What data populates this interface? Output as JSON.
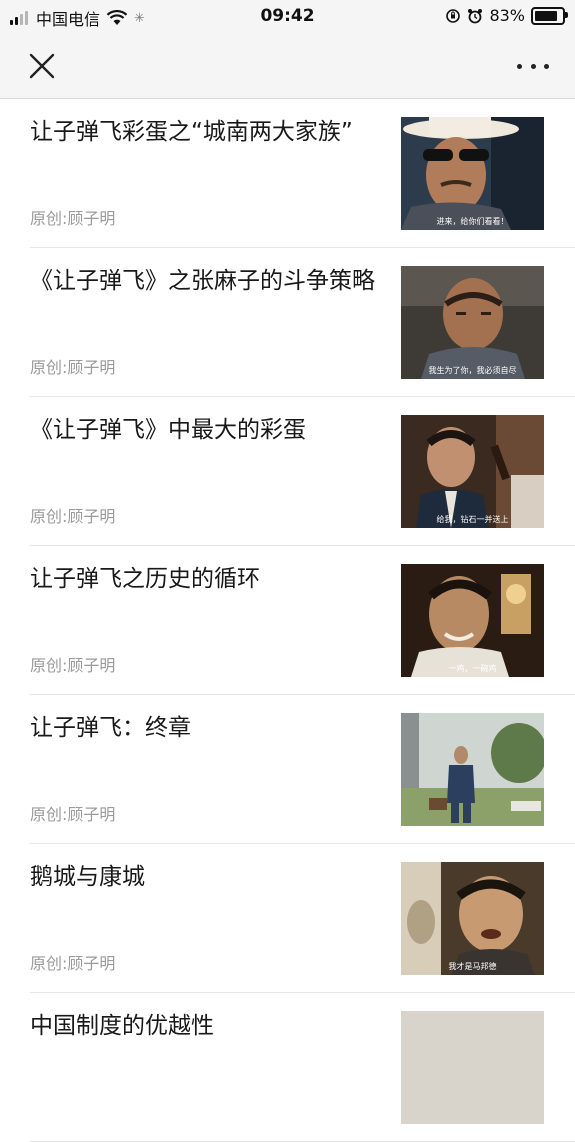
{
  "status_bar": {
    "carrier": "中国电信",
    "time": "09:42",
    "battery": "83%",
    "battery_level": 0.83,
    "signal_bars": 4,
    "signal_active": 2
  },
  "nav": {
    "close_icon": "close-icon",
    "more_icon": "more-dots-icon"
  },
  "articles": [
    {
      "title": "让子弹飞彩蛋之“城南两大家族”",
      "meta": "原创:顾子明",
      "thumb_caption": "进来，给你们看看！"
    },
    {
      "title": "《让子弹飞》之张麻子的斗争策略",
      "meta": "原创:顾子明",
      "thumb_caption": "我生为了你，我必须自尽"
    },
    {
      "title": "《让子弹飞》中最大的彩蛋",
      "meta": "原创:顾子明",
      "thumb_caption": "给我，钻石一并送上"
    },
    {
      "title": "让子弹飞之历史的循环",
      "meta": "原创:顾子明",
      "thumb_caption": "一鸡，一碗鸡"
    },
    {
      "title": "让子弹飞：终章",
      "meta": "原创:顾子明",
      "thumb_caption": ""
    },
    {
      "title": "鹅城与康城",
      "meta": "原创:顾子明",
      "thumb_caption": "我才是马邦德"
    },
    {
      "title": "中国制度的优越性",
      "meta": "",
      "thumb_caption": ""
    }
  ]
}
